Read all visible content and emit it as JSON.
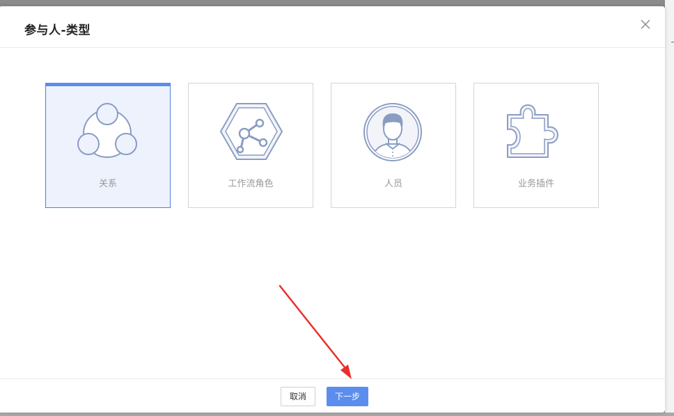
{
  "dialog": {
    "title": "参与人-类型"
  },
  "cards": [
    {
      "label": "关系",
      "icon": "relationship-icon",
      "selected": true
    },
    {
      "label": "工作流角色",
      "icon": "workflow-role-icon",
      "selected": false
    },
    {
      "label": "人员",
      "icon": "person-icon",
      "selected": false
    },
    {
      "label": "业务插件",
      "icon": "puzzle-plugin-icon",
      "selected": false
    }
  ],
  "footer": {
    "cancel_label": "取消",
    "next_label": "下一步"
  },
  "colors": {
    "accent": "#5b8def",
    "selected_background": "#edf2fd",
    "icon_stroke": "#8a9cc2",
    "annotation_arrow": "#e8302c"
  }
}
